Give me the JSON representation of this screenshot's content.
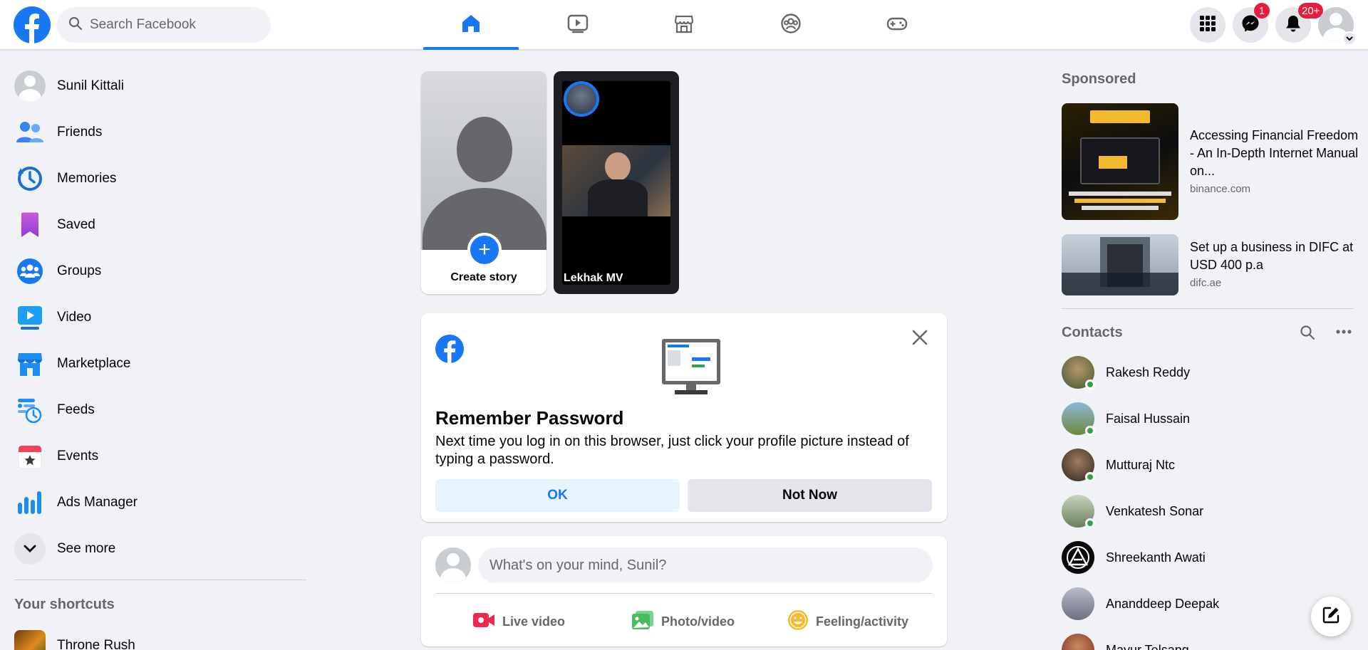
{
  "header": {
    "search_placeholder": "Search Facebook",
    "tabs": [
      {
        "name": "home",
        "active": true
      },
      {
        "name": "video",
        "active": false
      },
      {
        "name": "marketplace",
        "active": false
      },
      {
        "name": "groups",
        "active": false
      },
      {
        "name": "gaming",
        "active": false
      }
    ],
    "messenger_badge": "1",
    "notifications_badge": "20+",
    "colors": {
      "accent": "#1877f2",
      "badge": "#e41e3f"
    }
  },
  "sidebar": {
    "items": [
      {
        "label": "Sunil Kittali",
        "icon": "profile-avatar"
      },
      {
        "label": "Friends",
        "icon": "friends-icon"
      },
      {
        "label": "Memories",
        "icon": "memories-icon"
      },
      {
        "label": "Saved",
        "icon": "saved-icon"
      },
      {
        "label": "Groups",
        "icon": "groups-icon"
      },
      {
        "label": "Video",
        "icon": "video-icon"
      },
      {
        "label": "Marketplace",
        "icon": "marketplace-icon"
      },
      {
        "label": "Feeds",
        "icon": "feeds-icon"
      },
      {
        "label": "Events",
        "icon": "events-icon"
      },
      {
        "label": "Ads Manager",
        "icon": "ads-manager-icon"
      },
      {
        "label": "See more",
        "icon": "chevron-down-icon"
      }
    ],
    "shortcuts_title": "Your shortcuts",
    "shortcuts": [
      {
        "label": "Throne Rush"
      }
    ]
  },
  "stories": {
    "create_label": "Create story",
    "items": [
      {
        "label": "Lekhak MV"
      }
    ]
  },
  "remember_password": {
    "title": "Remember Password",
    "description": "Next time you log in on this browser, just click your profile picture instead of typing a password.",
    "ok_label": "OK",
    "not_now_label": "Not Now"
  },
  "composer": {
    "placeholder": "What's on your mind, Sunil?",
    "actions": [
      {
        "label": "Live video",
        "icon": "live-video-icon"
      },
      {
        "label": "Photo/video",
        "icon": "photo-video-icon"
      },
      {
        "label": "Feeling/activity",
        "icon": "feeling-icon"
      }
    ]
  },
  "sponsored": {
    "title": "Sponsored",
    "ads": [
      {
        "title": "Accessing Financial Freedom - An In-Depth Internet Manual on...",
        "domain": "binance.com"
      },
      {
        "title": "Set up a business in DIFC at USD 400 p.a",
        "domain": "difc.ae"
      }
    ]
  },
  "contacts": {
    "title": "Contacts",
    "items": [
      {
        "name": "Rakesh Reddy",
        "online": true
      },
      {
        "name": "Faisal Hussain",
        "online": true
      },
      {
        "name": "Mutturaj Ntc",
        "online": true
      },
      {
        "name": "Venkatesh Sonar",
        "online": true
      },
      {
        "name": "Shreekanth Awati",
        "online": false
      },
      {
        "name": "Ananddeep Deepak",
        "online": false
      },
      {
        "name": "Mayur Telsang",
        "online": false
      }
    ]
  }
}
